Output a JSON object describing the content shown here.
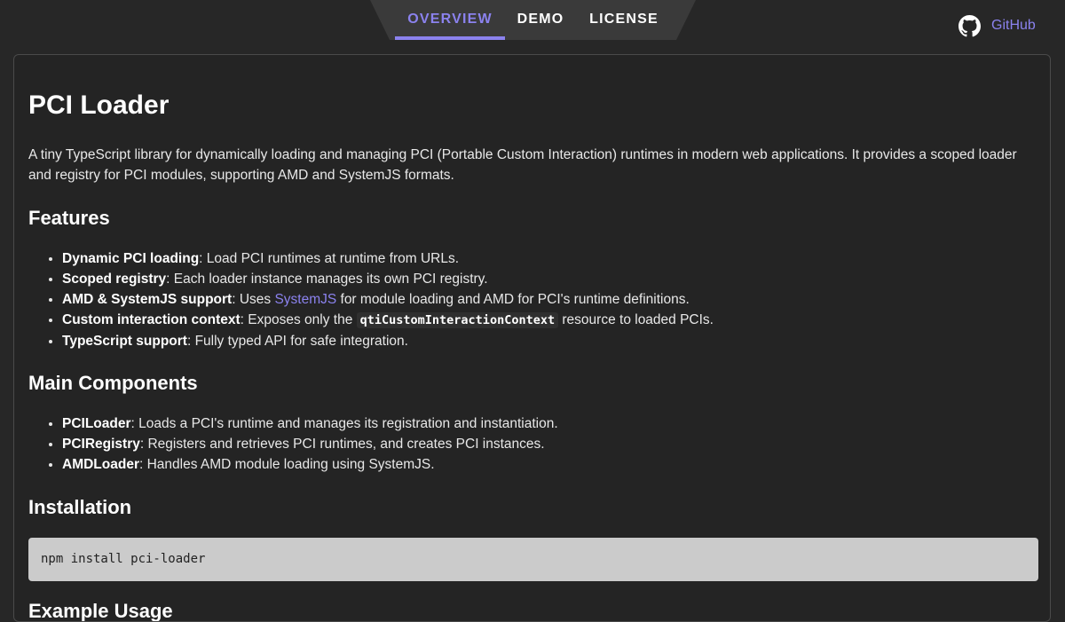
{
  "nav": {
    "tabs": [
      {
        "label": "OVERVIEW",
        "active": true
      },
      {
        "label": "DEMO",
        "active": false
      },
      {
        "label": "LICENSE",
        "active": false
      }
    ],
    "github_label": "GitHub",
    "github_icon": "github-icon"
  },
  "colors": {
    "accent": "#8b82ee",
    "background": "#272727",
    "panel": "#242424",
    "code_block": "#cbcbcb"
  },
  "main": {
    "title": "PCI Loader",
    "intro": "A tiny TypeScript library for dynamically loading and managing PCI (Portable Custom Interaction) runtimes in modern web applications. It provides a scoped loader and registry for PCI modules, supporting AMD and SystemJS formats.",
    "features": {
      "heading": "Features",
      "items": [
        {
          "bold": "Dynamic PCI loading",
          "text": ": Load PCI runtimes at runtime from URLs."
        },
        {
          "bold": "Scoped registry",
          "text": ": Each loader instance manages its own PCI registry."
        },
        {
          "bold": "AMD & SystemJS support",
          "pre": ": Uses ",
          "link": "SystemJS",
          "text": " for module loading and AMD for PCI's runtime definitions."
        },
        {
          "bold": "Custom interaction context",
          "pre": ": Exposes only the ",
          "code": "qtiCustomInteractionContext",
          "text": " resource to loaded PCIs."
        },
        {
          "bold": "TypeScript support",
          "text": ": Fully typed API for safe integration."
        }
      ]
    },
    "components": {
      "heading": "Main Components",
      "items": [
        {
          "bold": "PCILoader",
          "text": ": Loads a PCI's runtime and manages its registration and instantiation."
        },
        {
          "bold": "PCIRegistry",
          "text": ": Registers and retrieves PCI runtimes, and creates PCI instances."
        },
        {
          "bold": "AMDLoader",
          "text": ": Handles AMD module loading using SystemJS."
        }
      ]
    },
    "installation": {
      "heading": "Installation",
      "command": "npm install pci-loader"
    },
    "next_heading": "Example Usage"
  }
}
